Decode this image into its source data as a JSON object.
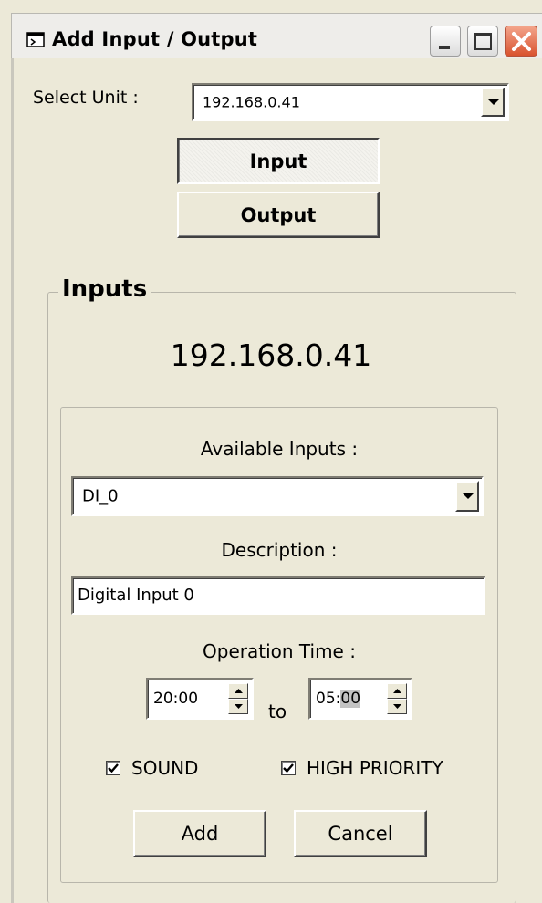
{
  "window": {
    "title": "Add Input / Output",
    "title_icon": "window-app-icon",
    "controls": [
      "minimize-icon",
      "maximize-icon",
      "close-icon"
    ]
  },
  "select_unit": {
    "label": "Select Unit :",
    "value": "192.168.0.41"
  },
  "mode_buttons": {
    "input_label": "Input",
    "output_label": "Output",
    "selected": "Input"
  },
  "inputs_group": {
    "legend": "Inputs",
    "unit_ip": "192.168.0.41",
    "available_label": "Available Inputs :",
    "available_value": "DI_0",
    "description_label": "Description :",
    "description_value": "Digital Input 0",
    "operation_time_label": "Operation Time :",
    "time_from": {
      "hour": "20",
      "minute": "00"
    },
    "to_label": "to",
    "time_to": {
      "hour": "05",
      "minute": "00"
    },
    "sound": {
      "label": "SOUND",
      "checked": true
    },
    "high_priority": {
      "label": "HIGH PRIORITY",
      "checked": true
    },
    "add_label": "Add",
    "cancel_label": "Cancel"
  },
  "colors": {
    "face": "#ece9d8",
    "close_button": "#d9532f"
  }
}
